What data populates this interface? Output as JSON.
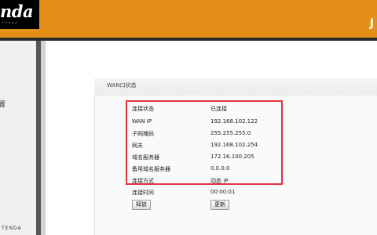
{
  "header": {
    "brand": "nda",
    "brand_sub": "TENDA"
  },
  "sidebar": {
    "item_label": "置",
    "footer": "TENDA"
  },
  "panel": {
    "title": "WAN口状态",
    "rows": [
      {
        "label": "连接状态",
        "value": "已连接"
      },
      {
        "label": "WAN IP",
        "value": "192.168.102.122"
      },
      {
        "label": "子网掩码",
        "value": "255.255.255.0"
      },
      {
        "label": "网关",
        "value": "192.168.102.254"
      },
      {
        "label": "域名服务器",
        "value": "172.16.100.205"
      },
      {
        "label": "备用域名服务器",
        "value": "0.0.0.0"
      },
      {
        "label": "连接方式",
        "value": "动态 IP"
      },
      {
        "label": "连接时间",
        "value": "00:00:01"
      }
    ],
    "release_button": "释放",
    "renew_button": "更新"
  },
  "colors": {
    "header": "#e48f17",
    "highlight": "#e0353f"
  }
}
